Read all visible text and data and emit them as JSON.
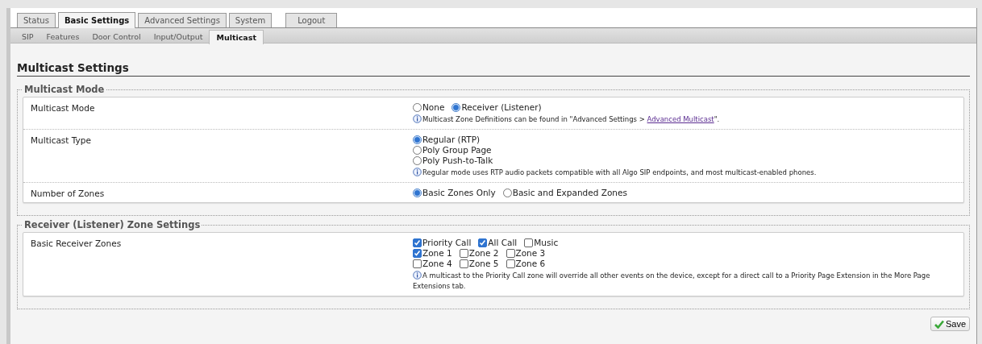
{
  "tabs": [
    {
      "label": "Status",
      "selected": false
    },
    {
      "label": "Basic Settings",
      "selected": true
    },
    {
      "label": "Advanced Settings",
      "selected": false
    },
    {
      "label": "System",
      "selected": false
    }
  ],
  "logout": "Logout",
  "subtabs": [
    {
      "label": "SIP",
      "selected": false
    },
    {
      "label": "Features",
      "selected": false
    },
    {
      "label": "Door Control",
      "selected": false
    },
    {
      "label": "Input/Output",
      "selected": false
    },
    {
      "label": "Multicast",
      "selected": true
    }
  ],
  "heading": "Multicast Settings",
  "sections": [
    {
      "legend": "Multicast Mode",
      "rows": [
        {
          "label": "Multicast Mode",
          "lines": [
            [
              {
                "kind": "radio",
                "label": "None",
                "checked": false
              },
              {
                "kind": "radio",
                "label": "Receiver (Listener)",
                "checked": true
              }
            ]
          ],
          "note": {
            "text": "Multicast Zone Definitions can be found in \"Advanced Settings > ",
            "link": "Advanced Multicast",
            "after": "\"."
          }
        },
        {
          "label": "Multicast Type",
          "lines": [
            [
              {
                "kind": "radio",
                "label": "Regular (RTP)",
                "checked": true
              }
            ],
            [
              {
                "kind": "radio",
                "label": "Poly Group Page",
                "checked": false
              }
            ],
            [
              {
                "kind": "radio",
                "label": "Poly Push-to-Talk",
                "checked": false
              }
            ]
          ],
          "note": {
            "text": "Regular mode uses RTP audio packets compatible with all Algo SIP endpoints, and most multicast-enabled phones."
          }
        },
        {
          "label": "Number of Zones",
          "lines": [
            [
              {
                "kind": "radio",
                "label": "Basic Zones Only",
                "checked": true
              },
              {
                "kind": "radio",
                "label": "Basic and Expanded Zones",
                "checked": false
              }
            ]
          ]
        }
      ]
    },
    {
      "legend": "Receiver (Listener) Zone Settings",
      "rows": [
        {
          "label": "Basic Receiver Zones",
          "lines": [
            [
              {
                "kind": "checkbox",
                "label": "Priority Call",
                "checked": true
              },
              {
                "kind": "checkbox",
                "label": "All Call",
                "checked": true
              },
              {
                "kind": "checkbox",
                "label": "Music",
                "checked": false
              }
            ],
            [
              {
                "kind": "checkbox",
                "label": "Zone 1",
                "checked": true
              },
              {
                "kind": "checkbox",
                "label": "Zone 2",
                "checked": false
              },
              {
                "kind": "checkbox",
                "label": "Zone 3",
                "checked": false
              }
            ],
            [
              {
                "kind": "checkbox",
                "label": "Zone 4",
                "checked": false
              },
              {
                "kind": "checkbox",
                "label": "Zone 5",
                "checked": false
              },
              {
                "kind": "checkbox",
                "label": "Zone 6",
                "checked": false
              }
            ]
          ],
          "note": {
            "text": "A multicast to the Priority Call zone will override all other events on the device, except for a direct call to a Priority Page Extension in the More Page Extensions tab."
          }
        }
      ]
    }
  ],
  "save": "Save"
}
